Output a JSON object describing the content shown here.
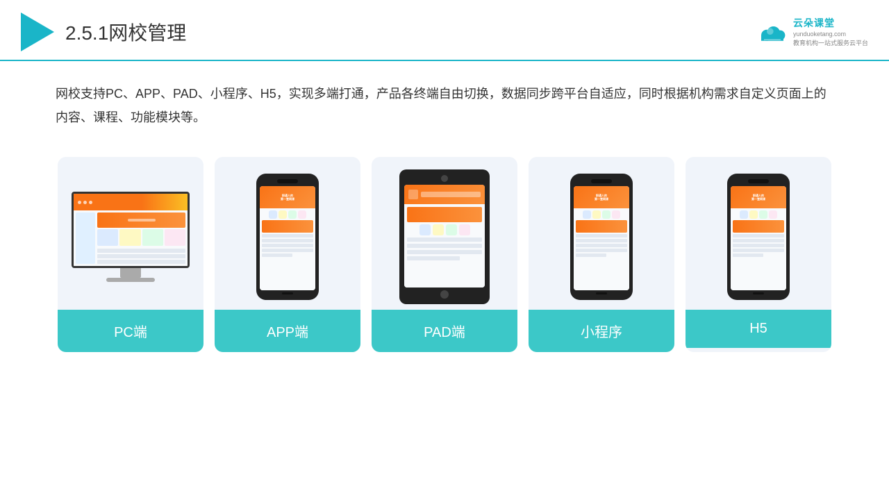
{
  "header": {
    "title": "2.5.1网校管理",
    "brand_name": "云朵课堂",
    "brand_url": "yunduoketang.com",
    "brand_slogan": "教育机构一站式服务云平台"
  },
  "description": {
    "text": "网校支持PC、APP、PAD、小程序、H5，实现多端打通，产品各终端自由切换，数据同步跨平台自适应，同时根据机构需求自定义页面上的内容、课程、功能模块等。"
  },
  "cards": [
    {
      "id": "pc",
      "label": "PC端"
    },
    {
      "id": "app",
      "label": "APP端"
    },
    {
      "id": "pad",
      "label": "PAD端"
    },
    {
      "id": "miniprogram",
      "label": "小程序"
    },
    {
      "id": "h5",
      "label": "H5"
    }
  ],
  "colors": {
    "accent": "#1ab5c8",
    "card_bg": "#eef2f8",
    "label_bg": "#3cc8c8"
  }
}
